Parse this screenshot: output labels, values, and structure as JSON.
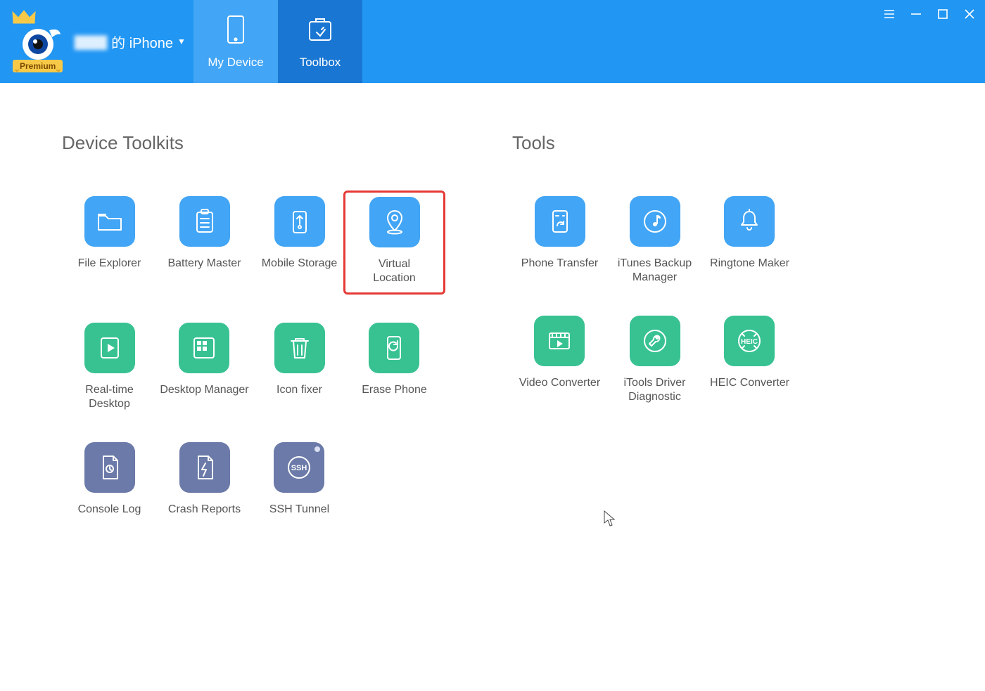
{
  "header": {
    "premium_badge": "Premium",
    "device_name_blurred": "▇▇▇",
    "device_suffix": "的 iPhone",
    "tabs": {
      "my_device": "My Device",
      "toolbox": "Toolbox"
    }
  },
  "sections": {
    "device_toolkits": "Device Toolkits",
    "tools": "Tools"
  },
  "device_toolkits": [
    {
      "id": "file-explorer",
      "label": "File Explorer",
      "color": "blue",
      "icon": "folder-icon"
    },
    {
      "id": "battery-master",
      "label": "Battery Master",
      "color": "blue",
      "icon": "clipboard-icon"
    },
    {
      "id": "mobile-storage",
      "label": "Mobile Storage",
      "color": "blue",
      "icon": "usb-disk-icon"
    },
    {
      "id": "virtual-location",
      "label": "Virtual Location",
      "color": "blue",
      "icon": "location-pin-icon",
      "highlight": true
    },
    {
      "id": "realtime-desktop",
      "label": "Real-time Desktop",
      "color": "green",
      "icon": "play-icon"
    },
    {
      "id": "desktop-manager",
      "label": "Desktop Manager",
      "color": "green",
      "icon": "apps-grid-icon"
    },
    {
      "id": "icon-fixer",
      "label": "Icon fixer",
      "color": "green",
      "icon": "trash-icon"
    },
    {
      "id": "erase-phone",
      "label": "Erase Phone",
      "color": "green",
      "icon": "phone-reset-icon"
    },
    {
      "id": "console-log",
      "label": "Console Log",
      "color": "slate",
      "icon": "log-file-icon"
    },
    {
      "id": "crash-reports",
      "label": "Crash Reports",
      "color": "slate",
      "icon": "crash-icon"
    },
    {
      "id": "ssh-tunnel",
      "label": "SSH Tunnel",
      "color": "slate",
      "icon": "ssh-icon",
      "dot": true,
      "text": "SSH"
    }
  ],
  "tools": [
    {
      "id": "phone-transfer",
      "label": "Phone Transfer",
      "color": "blue",
      "icon": "transfer-icon"
    },
    {
      "id": "itunes-backup",
      "label": "iTunes Backup Manager",
      "color": "blue",
      "icon": "music-note-icon"
    },
    {
      "id": "ringtone-maker",
      "label": "Ringtone Maker",
      "color": "blue",
      "icon": "bell-icon"
    },
    {
      "id": "video-converter",
      "label": "Video Converter",
      "color": "green",
      "icon": "video-icon"
    },
    {
      "id": "driver-diagnostic",
      "label": "iTools Driver Diagnostic",
      "color": "green",
      "icon": "wrench-icon"
    },
    {
      "id": "heic-converter",
      "label": "HEIC Converter",
      "color": "green",
      "icon": "heic-icon",
      "text": "HEIC"
    }
  ]
}
